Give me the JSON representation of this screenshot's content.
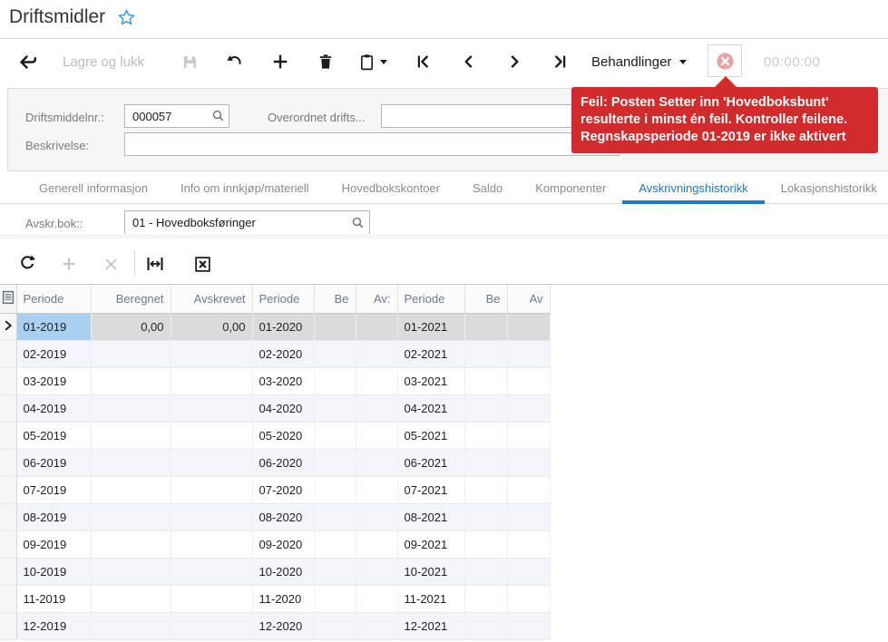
{
  "page": {
    "title": "Driftsmidler"
  },
  "toolbar": {
    "save_and_close": "Lagre og lukk",
    "actions": "Behandlinger",
    "timer": "00:00:00"
  },
  "error_tooltip": {
    "text": "Feil: Posten Setter inn 'Hovedboksbunt'\nresulterte i minst én feil. Kontroller feilene.\nRegnskapsperiode 01-2019 er ikke aktivert",
    "color": "#d22b2b"
  },
  "form": {
    "asset_number": {
      "label": "Driftsmiddelnr.:",
      "value": "000057"
    },
    "parent_asset": {
      "label": "Overordnet drifts...",
      "value": ""
    },
    "description": {
      "label": "Beskrivelse:",
      "value": ""
    }
  },
  "tabs": {
    "active_index": 5,
    "items": [
      "Generell informasjon",
      "Info om innkjøp/materiell",
      "Hovedbokskontoer",
      "Saldo",
      "Komponenter",
      "Avskrivningshistorikk",
      "Lokasjonshistorikk"
    ]
  },
  "filter": {
    "label": "Avskr.bok::",
    "value": "01 - Hovedboksføringer"
  },
  "grid": {
    "columns": [
      {
        "label": "Periode",
        "align": "left"
      },
      {
        "label": "Beregnet",
        "align": "right"
      },
      {
        "label": "Avskrevet",
        "align": "right"
      },
      {
        "label": "Periode",
        "align": "left"
      },
      {
        "label": "Be",
        "align": "right"
      },
      {
        "label": "Av:",
        "align": "right"
      },
      {
        "label": "Periode",
        "align": "left"
      },
      {
        "label": "Be",
        "align": "right"
      },
      {
        "label": "Av",
        "align": "right"
      }
    ],
    "selected": {
      "row": 0,
      "column": 0
    },
    "rows": [
      [
        "01-2019",
        "0,00",
        "0,00",
        "01-2020",
        "",
        "",
        "01-2021",
        "",
        ""
      ],
      [
        "02-2019",
        "",
        "",
        "02-2020",
        "",
        "",
        "02-2021",
        "",
        ""
      ],
      [
        "03-2019",
        "",
        "",
        "03-2020",
        "",
        "",
        "03-2021",
        "",
        ""
      ],
      [
        "04-2019",
        "",
        "",
        "04-2020",
        "",
        "",
        "04-2021",
        "",
        ""
      ],
      [
        "05-2019",
        "",
        "",
        "05-2020",
        "",
        "",
        "05-2021",
        "",
        ""
      ],
      [
        "06-2019",
        "",
        "",
        "06-2020",
        "",
        "",
        "06-2021",
        "",
        ""
      ],
      [
        "07-2019",
        "",
        "",
        "07-2020",
        "",
        "",
        "07-2021",
        "",
        ""
      ],
      [
        "08-2019",
        "",
        "",
        "08-2020",
        "",
        "",
        "08-2021",
        "",
        ""
      ],
      [
        "09-2019",
        "",
        "",
        "09-2020",
        "",
        "",
        "09-2021",
        "",
        ""
      ],
      [
        "10-2019",
        "",
        "",
        "10-2020",
        "",
        "",
        "10-2021",
        "",
        ""
      ],
      [
        "11-2019",
        "",
        "",
        "11-2020",
        "",
        "",
        "11-2021",
        "",
        ""
      ],
      [
        "12-2019",
        "",
        "",
        "12-2020",
        "",
        "",
        "12-2021",
        "",
        ""
      ]
    ]
  },
  "colors": {
    "accent_blue": "#1878d2",
    "selected_cell_blue": "#a9cff1",
    "selected_row_gray": "#dbdbdb",
    "alt_row_tint": "#f2f6fb",
    "error_red": "#d22b2b"
  },
  "icons": {
    "favorite-star-icon": "☆",
    "back-arrow-icon": "←",
    "save-icon": "💾",
    "undo-icon": "↶",
    "add-icon": "+",
    "delete-icon": "🗑",
    "clipboard-icon": "📋",
    "first-record-icon": "|<",
    "previous-record-icon": "<",
    "next-record-icon": ">",
    "last-record-icon": ">|",
    "caret-down-icon": "▾",
    "error-circle-icon": "⊗",
    "search-icon": "🔍",
    "refresh-icon": "⟳",
    "fit-width-icon": "|↔|",
    "export-excel-icon": "[X]",
    "row-chevron-icon": ">",
    "grid-settings-icon": "▤"
  }
}
